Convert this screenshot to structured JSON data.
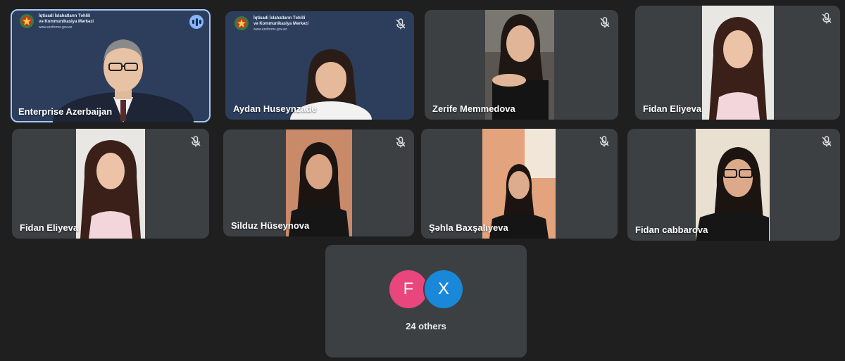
{
  "colors": {
    "background": "#1f1f1f",
    "tile": "#3c4043",
    "active_outline": "#a8c7fa",
    "org_panel": "#2c3e5c",
    "avatar_f": "#e8467c",
    "avatar_x": "#1a88d8"
  },
  "org": {
    "line1": "İqtisadi İslahatların Təhlili",
    "line2": "və Kommunikasiya Mərkəzi",
    "url": "www.ereforms.gov.az"
  },
  "participants": [
    {
      "name": "Enterprise Azerbaijan",
      "muted": false,
      "speaking": true,
      "icon": "speaking-indicator-icon"
    },
    {
      "name": "Aydan Huseynzade",
      "muted": true,
      "icon": "mic-off-icon"
    },
    {
      "name": "Zerife Memmedova",
      "muted": true,
      "icon": "mic-off-icon"
    },
    {
      "name": "Fidan Eliyeva",
      "muted": true,
      "icon": "mic-off-icon"
    },
    {
      "name": "Fidan Eliyeva",
      "muted": true,
      "icon": "mic-off-icon"
    },
    {
      "name": "Silduz Hüseynova",
      "muted": true,
      "icon": "mic-off-icon"
    },
    {
      "name": "Şəhla Baxşalıyeva",
      "muted": true,
      "icon": "mic-off-icon"
    },
    {
      "name": "Fidan cabbarova",
      "muted": true,
      "icon": "mic-off-icon"
    }
  ],
  "others": {
    "avatars": [
      "F",
      "X"
    ],
    "label": "24 others"
  }
}
